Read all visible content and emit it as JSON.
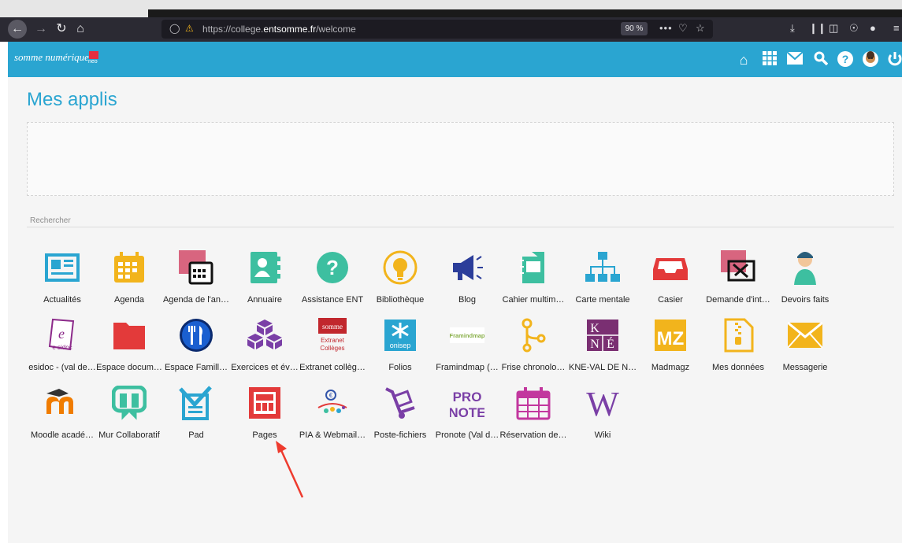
{
  "browser": {
    "url_prefix": "https://college.",
    "url_domain": "entsomme.fr",
    "url_suffix": "/welcome",
    "zoom": "90 %",
    "more_label": "•••"
  },
  "header": {
    "logo_text": "somme numérique",
    "logo_badge": "neo"
  },
  "page": {
    "title": "Mes applis",
    "search_label": "Rechercher"
  },
  "apps": [
    {
      "label": "Actualités",
      "icon": "newspaper-icon",
      "color": "#2aa5d1"
    },
    {
      "label": "Agenda",
      "icon": "calendar-icon",
      "color": "#f2b41c"
    },
    {
      "label": "Agenda de l'an…",
      "icon": "annual-calendar-icon",
      "color": "#d8657f"
    },
    {
      "label": "Annuaire",
      "icon": "contacts-icon",
      "color": "#3dbfa0"
    },
    {
      "label": "Assistance ENT",
      "icon": "question-icon",
      "color": "#3dbfa0"
    },
    {
      "label": "Bibliothèque",
      "icon": "lightbulb-icon",
      "color": "#f2b41c"
    },
    {
      "label": "Blog",
      "icon": "megaphone-icon",
      "color": "#2b3d9a"
    },
    {
      "label": "Cahier multim…",
      "icon": "notebook-icon",
      "color": "#3dbfa0"
    },
    {
      "label": "Carte mentale",
      "icon": "sitemap-icon",
      "color": "#2aa5d1"
    },
    {
      "label": "Casier",
      "icon": "inbox-icon",
      "color": "#e33a3a"
    },
    {
      "label": "Demande d'int…",
      "icon": "tools-icon",
      "color": "#d8657f"
    },
    {
      "label": "Devoirs faits",
      "icon": "avatar-icon",
      "color": "#3dbfa0"
    },
    {
      "label": "esidoc - (val de…",
      "icon": "esidoc-icon",
      "color": "#8c2a8a",
      "text": "e sidoc"
    },
    {
      "label": "Espace docum…",
      "icon": "folder-icon",
      "color": "#e33a3a"
    },
    {
      "label": "Espace Famill…",
      "icon": "cutlery-icon",
      "color": "#1a5fd0"
    },
    {
      "label": "Exercices et év…",
      "icon": "cubes-icon",
      "color": "#7a3fa6"
    },
    {
      "label": "Extranet collèg…",
      "icon": "extranet-icon",
      "color": "#c1272d",
      "text": "Extranet Collèges"
    },
    {
      "label": "Folios",
      "icon": "onisep-icon",
      "color": "#2aa5d1",
      "text": "onisep"
    },
    {
      "label": "Framindmap (…",
      "icon": "framindmap-icon",
      "color": "#8ab04a",
      "text": "Framindmap"
    },
    {
      "label": "Frise chronolo…",
      "icon": "timeline-icon",
      "color": "#f2b41c"
    },
    {
      "label": "KNE-VAL DE N…",
      "icon": "kne-icon",
      "color": "#7a2f72",
      "text": "K NÉ"
    },
    {
      "label": "Madmagz",
      "icon": "madmagz-icon",
      "color": "#f2b41c",
      "text": "MZ"
    },
    {
      "label": "Mes données",
      "icon": "zip-file-icon",
      "color": "#f2b41c"
    },
    {
      "label": "Messagerie",
      "icon": "envelope-icon",
      "color": "#f2b41c"
    },
    {
      "label": "Moodle acadé…",
      "icon": "moodle-icon",
      "color": "#f07c00"
    },
    {
      "label": "Mur Collaboratif",
      "icon": "padlet-icon",
      "color": "#3dbfa0"
    },
    {
      "label": "Pad",
      "icon": "pad-icon",
      "color": "#2aa5d1"
    },
    {
      "label": "Pages",
      "icon": "pages-icon",
      "color": "#e33a3a"
    },
    {
      "label": "PIA & Webmail…",
      "icon": "pia-icon",
      "color": "#2aa5d1"
    },
    {
      "label": "Poste-fichiers",
      "icon": "trolley-icon",
      "color": "#7a3fa6"
    },
    {
      "label": "Pronote (Val d…",
      "icon": "pronote-icon",
      "color": "#7a3fa6",
      "text": "PRO NOTE"
    },
    {
      "label": "Réservation de…",
      "icon": "booking-icon",
      "color": "#c2379e"
    },
    {
      "label": "Wiki",
      "icon": "wiki-icon",
      "color": "#7a3fa6",
      "text": "W"
    }
  ]
}
